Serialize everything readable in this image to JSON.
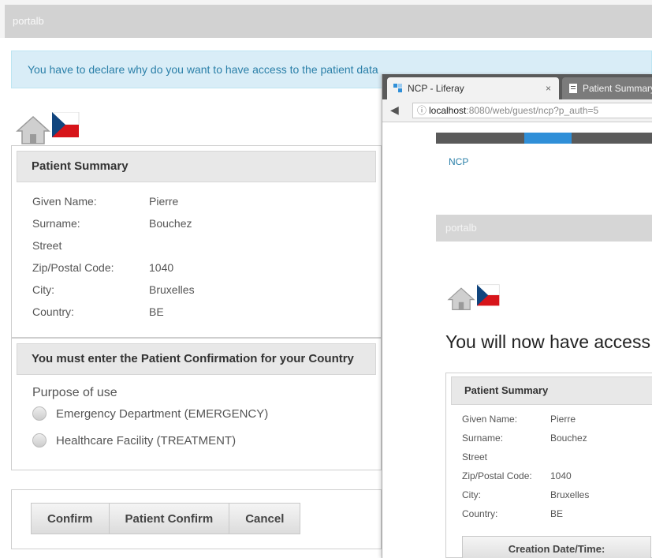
{
  "portlet_title": "portalb",
  "alert_text": "You have to declare why do you want to have access to the patient data",
  "patient_summary": {
    "title": "Patient Summary",
    "fields": [
      {
        "label": "Given Name:",
        "value": "Pierre"
      },
      {
        "label": "Surname:",
        "value": "Bouchez"
      },
      {
        "label": "Street",
        "value": ""
      },
      {
        "label": "Zip/Postal Code:",
        "value": "1040"
      },
      {
        "label": "City:",
        "value": "Bruxelles"
      },
      {
        "label": "Country:",
        "value": "BE"
      }
    ]
  },
  "confirmation": {
    "title": "You must enter the Patient Confirmation for your Country",
    "purpose_label": "Purpose of use",
    "options": [
      "Emergency Department (EMERGENCY)",
      "Healthcare Facility (TREATMENT)"
    ]
  },
  "buttons": {
    "confirm": "Confirm",
    "patient_confirm": "Patient Confirm",
    "cancel": "Cancel"
  },
  "popup": {
    "tab_active": "NCP - Liferay",
    "tab_inactive": "Patient Summary",
    "url_host": "localhost",
    "url_rest": ":8080/web/guest/ncp?p_auth=5",
    "ncp_link": "NCP",
    "portlet_title": "portalb",
    "heading": "You will now have access to the patient data",
    "summary_title": "Patient Summary",
    "fields": [
      {
        "label": "Given Name:",
        "value": "Pierre"
      },
      {
        "label": "Surname:",
        "value": "Bouchez"
      },
      {
        "label": "Street",
        "value": ""
      },
      {
        "label": "Zip/Postal Code:",
        "value": "1040"
      },
      {
        "label": "City:",
        "value": "Bruxelles"
      },
      {
        "label": "Country:",
        "value": "BE"
      }
    ],
    "creation_button": "Creation Date/Time:"
  },
  "icons": {
    "home": "home-icon",
    "flag": "czech-flag-icon"
  },
  "colors": {
    "alert_bg": "#d9edf7",
    "alert_text": "#2a7fa8",
    "bar_bg": "#d2d2d2",
    "nav_highlight": "#2f8fd8"
  }
}
